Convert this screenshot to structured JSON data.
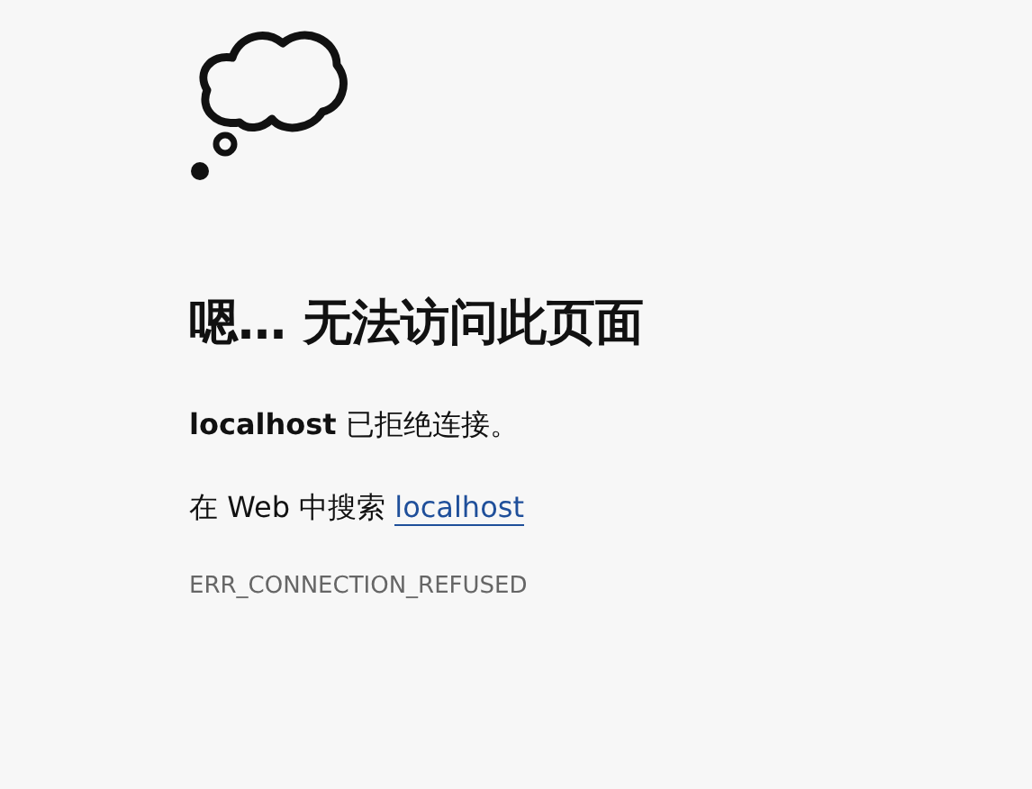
{
  "heading": "嗯… 无法访问此页面",
  "message": "**localhost** 已拒绝连接。",
  "search": {
    "prefix": "在 Web 中搜索",
    "link": "localhost"
  },
  "error_code": "ERR_CONNECTION_REFUSED"
}
